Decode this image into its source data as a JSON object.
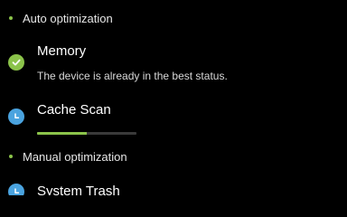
{
  "sections": {
    "auto": {
      "label": "Auto optimization",
      "items": {
        "memory": {
          "title": "Memory",
          "description": "The device is already in the best status.",
          "state": "done",
          "icon": "checkmark-icon"
        },
        "cache_scan": {
          "title": "Cache Scan",
          "state": "in-progress",
          "icon": "clock-icon",
          "progress": 0.5
        }
      }
    },
    "manual": {
      "label": "Manual optimization",
      "items": {
        "system_trash": {
          "title": "System Trash",
          "state": "in-progress",
          "icon": "clock-icon"
        }
      }
    }
  },
  "colors": {
    "background": "#000000",
    "accent_green": "#8bc34a",
    "pending_blue": "#4aa3df",
    "track": "#3a3a3a"
  }
}
